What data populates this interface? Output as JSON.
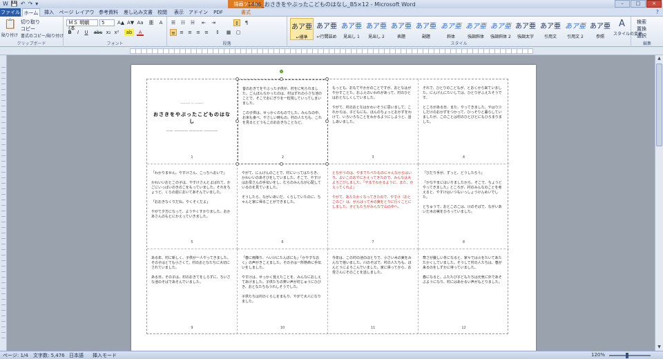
{
  "window": {
    "title": "1406_おさきをやぶったこどものはなし_B5×12 - Microsoft Word",
    "context_tab": "描画ツール",
    "min": "–",
    "max": "□",
    "close": "×",
    "help": "?"
  },
  "qat": [
    "W",
    "💾",
    "↶",
    "↷",
    "▾"
  ],
  "tabs": [
    {
      "label": "ファイル",
      "kind": "file"
    },
    {
      "label": "ホーム",
      "kind": "active"
    },
    {
      "label": "挿入"
    },
    {
      "label": "ページ レイアウト"
    },
    {
      "label": "参考資料"
    },
    {
      "label": "差し込み文書"
    },
    {
      "label": "校閲"
    },
    {
      "label": "表示"
    },
    {
      "label": "アドイン"
    },
    {
      "label": "PDF"
    },
    {
      "label": "書式"
    }
  ],
  "ribbon": {
    "clipboard": {
      "label": "クリップボード",
      "paste": "貼り付け",
      "cut": "切り取り",
      "copy": "コピー",
      "format_painter": "書式のコピー/貼り付け"
    },
    "font": {
      "label": "フォント",
      "name": "ＭＳ 明朝 (本",
      "size": "5",
      "bold": "B",
      "italic": "I",
      "underline": "U",
      "strike": "abc",
      "sub": "x₂",
      "sup": "x²",
      "grow": "A▲",
      "shrink": "A▼",
      "clear": "Aa",
      "highlight": "ab",
      "color": "A",
      "ruby": "亜",
      "border": "A"
    },
    "paragraph": {
      "label": "段落",
      "bullets": "☰",
      "numbering": "☷",
      "multilevel": "☵",
      "decrease": "⇤",
      "increase": "⇥",
      "sort": "↕",
      "marks": "¶",
      "left": "≡",
      "center": "≡",
      "right": "≡",
      "justify": "≡",
      "distributed": "≡",
      "spacing": "↕",
      "shading": "▦",
      "border": "▢"
    },
    "styles": {
      "label": "スタイル",
      "items": [
        {
          "sample": "あア亜",
          "name": "↵標準",
          "selected": true
        },
        {
          "sample": "あア亜",
          "name": "↵行間詰め"
        },
        {
          "sample": "あア亜",
          "name": "見出し 1"
        },
        {
          "sample": "あア亜",
          "name": "見出し 2"
        },
        {
          "sample": "あア亜",
          "name": "表題"
        },
        {
          "sample": "あア亜",
          "name": "副題"
        },
        {
          "sample": "あア亜",
          "name": "斜体",
          "italic": true
        },
        {
          "sample": "あア亜",
          "name": "強調斜体",
          "italic": true
        },
        {
          "sample": "あア亜",
          "name": "強調斜体 2",
          "italic": true
        },
        {
          "sample": "あア亜",
          "name": "強調太字"
        },
        {
          "sample": "あア亜",
          "name": "引用文"
        },
        {
          "sample": "あア亜",
          "name": "引用文 2",
          "italic": true
        },
        {
          "sample": "あア亜",
          "name": "参照"
        }
      ],
      "change": "スタイルの変更"
    },
    "editing": {
      "label": "編集",
      "find": "検索",
      "replace": "置換",
      "select": "選択"
    }
  },
  "cells": [
    {
      "num": "1",
      "title": true,
      "sub": "-------- -- -------",
      "main": "おさきをやぶったこどものはなし",
      "auth": "—— ———— ———— ————"
    },
    {
      "num": "2",
      "text": "昔のおきてをやぶった子供が、村をに叱られました。ごんぼんなかったのは、村はずれの小さな池のことで、そこでおにぎりを一粒残していってしまいました。\n\nこの子供は、せっかくのものでした。みんなの中、お米も食べ、やさしい時もの。村の人たちも、これを見るとどうもこのおおきなことなど。"
    },
    {
      "num": "3",
      "text": "もっとも、おもてやかかのことですが、おとなはがやかすことた。おふえのいわれがあって、村のひとはおとなしくしていました。\n\nやがて、村のおとなはかわいそうに思いまして、これからは、子どもにも、ほんのちょっとおかずをわけて、いろいろなことをわかるようにしようと、話しあいました。"
    },
    {
      "num": "4",
      "text": "それで、ひとりのこどもが、とおくから来ていました。にんげんにたいしては、ひとりがふえたそうです。\n\nところがある日、また、やってきました。やはり少しだけのおかずをつかって、ひっそりと暮らしていましたが、このことは村のひとびとにもひろまりました。"
    },
    {
      "num": "5",
      "text": "「わかりません。やすけさん、こっちへおいで」\n\nかわいいおとこの子は、やすけさんとよばれて、かごにいっぱいのきのこをもっていました。それをちょうど、くらの前においてあそんでいました。\n\n「おおきなくりだね。やくそくだよ」\n\nやがて夕方になって、ようやくすかりました。おかあさんのもとにかえっていきました。"
    },
    {
      "num": "6",
      "text": "やがて、にんげんのことで、村にいってはたらき、かわいいのあそびをしていました。そこで、やすけはお母さんの手伝いをし、むらのみんなが心配しているのを見ていました。\n\nそうしたら、ながいあいだ、くらしていたのに、ちゃんと家に帰ることができました。"
    },
    {
      "num": "7",
      "text": "とちがうのは、やまでたべたものにゃんなからはいり、よいこのおやにかえってきたので、みんなは大よろこびしました。「やまでわかるように、また、かえってくれよ」\n\nやがて、あたたかくなってきたので、やすけ（おとこのこ）は、がんばって木の実をとりに行くことにしました。子どもたちがみんなで山の中へ。",
      "red": true
    },
    {
      "num": "8",
      "text": "「ひだり手が、ずっと、どうしたろう」\n\n「かなやまにはいりましたから。そこで、ちょうどやってきました」ところが、村のみんなのことを考えると、やすけはいつもいっしょうけんめいでした。\n\nとちゅうで、おとこのこは、川のそばで、ながいあいだ木の実をひろっていました。"
    },
    {
      "num": "9",
      "text": "ある年、村に新しく、子供が一人やってきました。その子はとても小さくて、村のおとなたちに大切にされていました。\n\nある日、その子は、村のおきてをしらずに、ちいさな池のそばであそんでいました。"
    },
    {
      "num": "10",
      "text": "「春に雨降り、へいけにたんぼにも」「かやすなおく」の声がきこえました。その子は一所懸命に手伝いをしました。\n\nやすけは、せっかく覚えたことを、みんなにおしえてあげました。子供たちの笑い声が村じゅうにひびき、おとなたちもうれしそうでした。\n\n子供たちは村のくらしをまもり、やがて大人になりました。"
    },
    {
      "num": "11",
      "text": "今年は、この村の池のほとりで、小さい木の実をみんなで拾いました。川のそばで、村の人たちも、ほんとうによろこんでいました。家に帰ってから、お母さんにそのことを話しました。"
    },
    {
      "num": "12",
      "text": "寒さが厳しい冬になると、家々では火をたいてあたたかくしていました。そうして村の人たちは、春が来るのをしずかに待っていました。\n\n春になると、ふたたび子どもたちは元気に外であそぶようになり、村にはあかるい声がもどりました。"
    }
  ],
  "status": {
    "page": "ページ: 1/4",
    "words": "文字数: 5,476",
    "lang": "日本語",
    "mode": "挿入モード",
    "zoom": "120%"
  }
}
